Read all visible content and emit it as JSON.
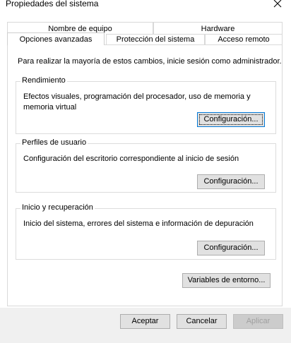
{
  "window": {
    "title": "Propiedades del sistema",
    "close_icon": "close-icon"
  },
  "tabs": {
    "row_back": [
      {
        "label": "Nombre de equipo"
      },
      {
        "label": "Hardware"
      }
    ],
    "row_front": [
      {
        "label": "Opciones avanzadas",
        "active": true
      },
      {
        "label": "Protección del sistema"
      },
      {
        "label": "Acceso remoto"
      }
    ]
  },
  "panel": {
    "intro": "Para realizar la mayoría de estos cambios, inicie sesión como administrador.",
    "groups": [
      {
        "title": "Rendimiento",
        "description": "Efectos visuales, programación del procesador, uso de memoria y memoria virtual",
        "button": "Configuración..."
      },
      {
        "title": "Perfiles de usuario",
        "description": "Configuración del escritorio correspondiente al inicio de sesión",
        "button": "Configuración..."
      },
      {
        "title": "Inicio y recuperación",
        "description": "Inicio del sistema, errores del sistema e información de depuración",
        "button": "Configuración..."
      }
    ],
    "env_button": "Variables de entorno..."
  },
  "footer": {
    "accept": "Aceptar",
    "cancel": "Cancelar",
    "apply": "Aplicar"
  },
  "colors": {
    "focus_border": "#0078d7",
    "button_bg": "#e1e1e1",
    "footer_bg": "#f0f0f0"
  }
}
